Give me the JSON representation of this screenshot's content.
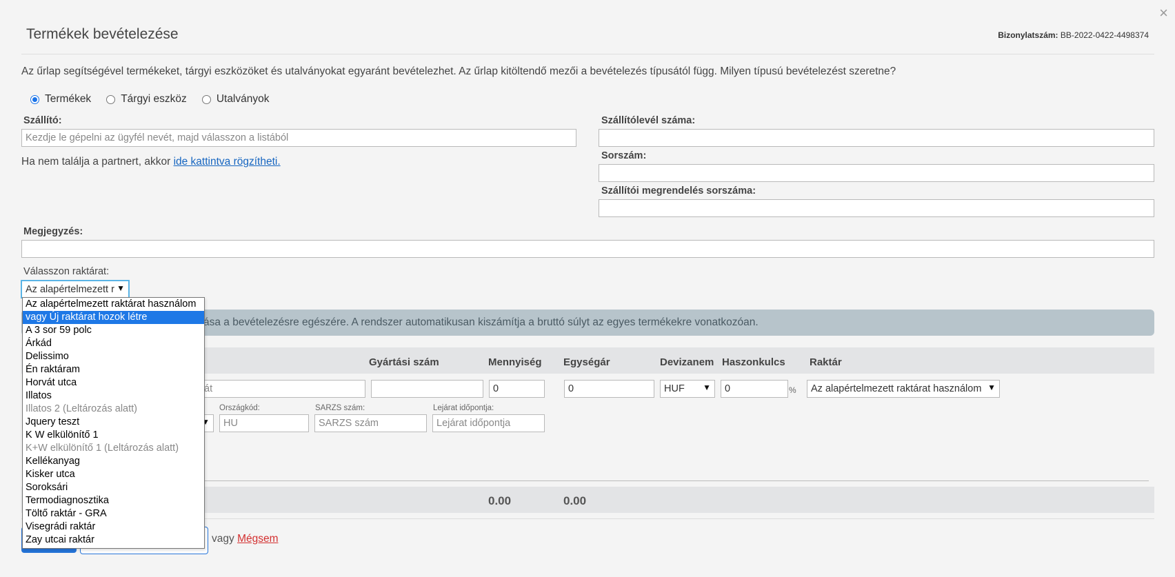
{
  "dialog": {
    "title": "Termékek bevételezése",
    "doc_label": "Bizonylatszám:",
    "doc_number": "BB-2022-0422-4498374",
    "close_symbol": "×"
  },
  "intro": "Az űrlap segítségével termékeket, tárgyi eszközöket és utalványokat egyaránt bevételezhet. Az űrlap kitöltendő mezői a bevételezés típusától függ. Milyen típusú bevételezést szeretne?",
  "type_options": [
    {
      "label": "Termékek",
      "checked": true
    },
    {
      "label": "Tárgyi eszköz",
      "checked": false
    },
    {
      "label": "Utalványok",
      "checked": false
    }
  ],
  "supplier": {
    "label": "Szállító:",
    "placeholder": "Kezdje le gépelni az ügyfél nevét, majd válasszon a listából",
    "hint_prefix": "Ha nem találja a partnert, akkor ",
    "hint_link": "ide kattintva rögzítheti."
  },
  "right_fields": {
    "delivery_note_label": "Szállítólevél száma:",
    "serial_label": "Sorszám:",
    "order_serial_label": "Szállítói megrendelés sorszáma:"
  },
  "note": {
    "label": "Megjegyzés:"
  },
  "warehouse": {
    "label": "Válasszon raktárat:",
    "selected_truncated": "Az alapértelmezett r",
    "options": [
      {
        "label": "Az alapértelmezett raktárat használom",
        "state": "normal"
      },
      {
        "label": "vagy Új raktárat hozok létre",
        "state": "highlighted"
      },
      {
        "label": "A 3 sor 59 polc",
        "state": "normal"
      },
      {
        "label": "Árkád",
        "state": "normal"
      },
      {
        "label": "Delissimo",
        "state": "normal"
      },
      {
        "label": "Én raktáram",
        "state": "normal"
      },
      {
        "label": "Horvát utca",
        "state": "normal"
      },
      {
        "label": "Illatos",
        "state": "normal"
      },
      {
        "label": "Illatos 2 (Leltározás alatt)",
        "state": "disabled"
      },
      {
        "label": "Jquery teszt",
        "state": "normal"
      },
      {
        "label": "K W elkülönítő 1",
        "state": "normal"
      },
      {
        "label": "K+W elkülönítő 1 (Leltározás alatt)",
        "state": "disabled"
      },
      {
        "label": "Kellékanyag",
        "state": "normal"
      },
      {
        "label": "Kisker utca",
        "state": "normal"
      },
      {
        "label": "Soroksári",
        "state": "normal"
      },
      {
        "label": "Termodiagnosztika",
        "state": "normal"
      },
      {
        "label": "Töltő raktár - GRA",
        "state": "normal"
      },
      {
        "label": "Visegrádi raktár",
        "state": "normal"
      },
      {
        "label": "Zay utcai raktár",
        "state": "normal"
      }
    ]
  },
  "info_text": "ása a bevételezésre egészére. A rendszer automatikusan kiszámítja a bruttó súlyt az egyes termékekre vonatkozóan.",
  "table": {
    "headers": {
      "mfg_number": "Gyártási szám",
      "quantity": "Mennyiség",
      "unit_price": "Egységár",
      "currency": "Devizanem",
      "margin": "Haszonkulcs",
      "warehouse": "Raktár"
    },
    "row": {
      "product_partial": "át",
      "quantity": "0",
      "unit_price": "0",
      "currency": "HUF",
      "margin": "0",
      "percent": "%",
      "warehouse": "Az alapértelmezett raktárat használom"
    },
    "sub": {
      "country_label": "Országkód:",
      "country_placeholder": "HU",
      "batch_label": "SARZS szám:",
      "batch_placeholder": "SARZS szám",
      "expiry_label": "Lejárat időpontja:",
      "expiry_placeholder": "Lejárat időpontja"
    },
    "totals": {
      "quantity": "0.00",
      "unit_price": "0.00"
    }
  },
  "footer": {
    "or_text": "vagy ",
    "cancel": "Mégsem"
  },
  "colors": {
    "accent": "#1e78e6",
    "info_bar": "#b7c4cb",
    "cancel_link": "#d32f2f"
  }
}
